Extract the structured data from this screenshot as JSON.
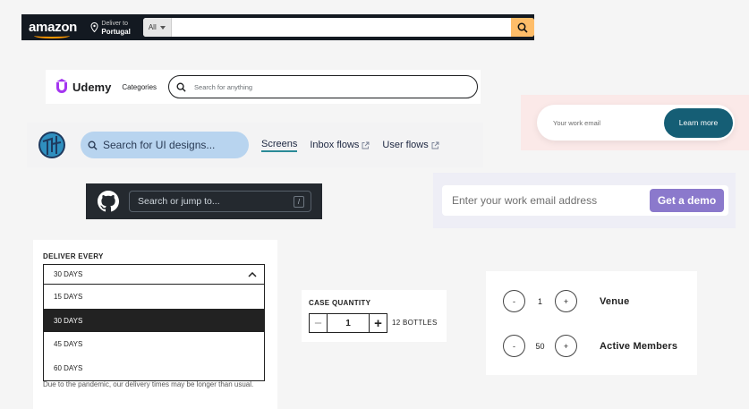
{
  "amazon": {
    "logo_text": "amazon",
    "deliver_line1": "Deliver to",
    "deliver_line2": "Portugal",
    "category": "All",
    "colors": {
      "bar": "#131921",
      "search_button": "#febd69"
    },
    "icons": [
      "location-pin-icon",
      "search-icon"
    ]
  },
  "udemy": {
    "logo_text": "Udemy",
    "categories_label": "Categories",
    "search_placeholder": "Search for anything",
    "colors": {
      "logo": "#a435f0"
    }
  },
  "dribbble": {
    "search_placeholder": "Search for UI designs...",
    "nav": [
      {
        "label": "Screens",
        "active": true
      },
      {
        "label": "Inbox flows",
        "icon": "external-link-icon"
      },
      {
        "label": "User flows",
        "icon": "external-link-icon"
      }
    ],
    "colors": {
      "search_bg": "#b8d4ef",
      "active_underline": "#2a8a97"
    }
  },
  "github": {
    "search_placeholder": "Search or jump to...",
    "shortcut_key": "/",
    "colors": {
      "bar": "#24292f"
    }
  },
  "work_email": {
    "placeholder": "Your work email",
    "button_label": "Learn more",
    "colors": {
      "button": "#155e75"
    }
  },
  "demo": {
    "placeholder": "Enter your work email address",
    "button_label": "Get a demo",
    "colors": {
      "button": "#8b79cc"
    }
  },
  "deliver_every": {
    "label": "DELIVER EVERY",
    "selected": "30 DAYS",
    "options": [
      "15 DAYS",
      "30 DAYS",
      "45 DAYS",
      "60 DAYS"
    ],
    "note": "Due to the pandemic, our delivery times may be longer than usual."
  },
  "case_quantity": {
    "label": "CASE QUANTITY",
    "minus": "−",
    "value": "1",
    "plus": "+",
    "units": "12 BOTTLES"
  },
  "counters": [
    {
      "minus": "-",
      "value": "1",
      "plus": "+",
      "name": "Venue"
    },
    {
      "minus": "-",
      "value": "50",
      "plus": "+",
      "name": "Active Members"
    }
  ]
}
